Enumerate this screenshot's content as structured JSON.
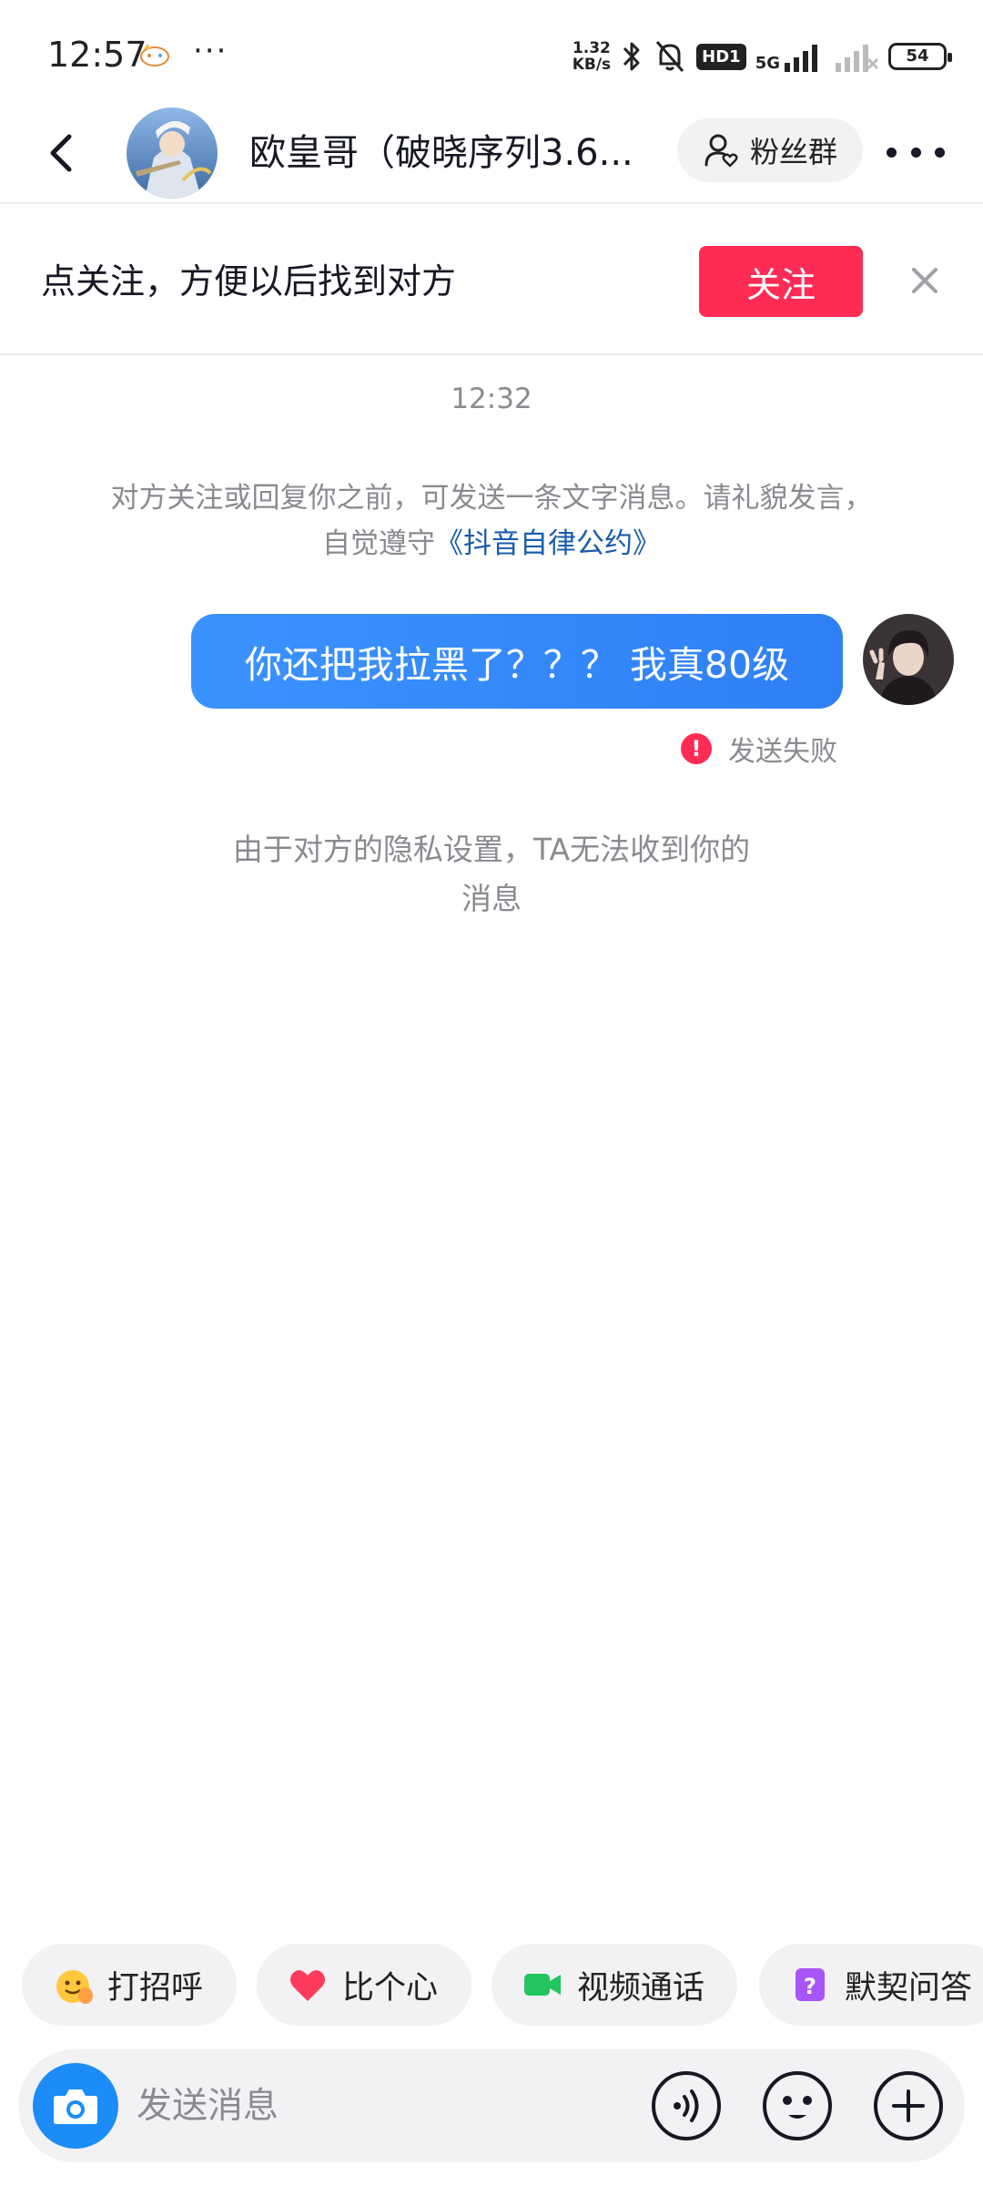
{
  "status_bar": {
    "time": "12:57",
    "more": "···",
    "network_speed_value": "1.32",
    "network_speed_unit": "KB/s",
    "hd_badge": "HD1",
    "signal_label": "5G",
    "battery": "54",
    "icons": [
      "app-notification-icon",
      "bluetooth-icon",
      "mute-bell-icon",
      "hd-icon",
      "signal-icon",
      "no-signal-icon",
      "battery-icon"
    ]
  },
  "header": {
    "title": "欧皇哥（破晓序列3.6...",
    "fan_group_label": "粉丝群"
  },
  "follow_banner": {
    "text": "点关注，方便以后找到对方",
    "button_label": "关注"
  },
  "messages": {
    "time": "12:32",
    "system_notice_text": "对方关注或回复你之前，可发送一条文字消息。请礼貌发言，自觉遵守",
    "system_notice_link": "《抖音自律公约》",
    "sent_message": "你还把我拉黑了？？？ 我真80级",
    "send_status": "发送失败",
    "fail_mark": "!",
    "privacy_notice_line1": "由于对方的隐私设置，TA无法收到你的",
    "privacy_notice_line2": "消息"
  },
  "quick_actions": [
    {
      "label": "打招呼",
      "icon": "waving-emoji-icon"
    },
    {
      "label": "比个心",
      "icon": "heart-icon"
    },
    {
      "label": "视频通话",
      "icon": "video-camera-icon"
    },
    {
      "label": "默契问答",
      "icon": "question-card-icon"
    }
  ],
  "input_bar": {
    "placeholder": "发送消息"
  },
  "colors": {
    "accent_red": "#fe2c55",
    "bubble_blue": "#2f7ff5",
    "camera_blue": "#1c8cf8",
    "link_blue": "#1a5dab",
    "muted_text": "#8a8b91"
  }
}
